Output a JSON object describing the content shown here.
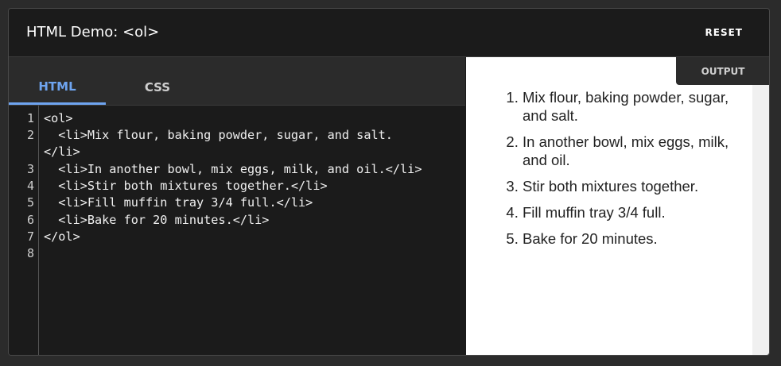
{
  "header": {
    "title": "HTML Demo: <ol>",
    "reset_label": "RESET"
  },
  "tabs": [
    {
      "label": "HTML"
    },
    {
      "label": "CSS"
    }
  ],
  "editor": {
    "line_numbers": [
      "1",
      "2",
      "3",
      "4",
      "5",
      "6",
      "7",
      "8"
    ],
    "lines": [
      "<ol>",
      "  <li>Mix flour, baking powder, sugar, and salt.",
      "</li>",
      "  <li>In another bowl, mix eggs, milk, and oil.</li>",
      "  <li>Stir both mixtures together.</li>",
      "  <li>Fill muffin tray 3/4 full.</li>",
      "  <li>Bake for 20 minutes.</li>",
      "</ol>"
    ]
  },
  "output": {
    "label": "OUTPUT",
    "items": [
      "Mix flour, baking powder, sugar, and salt.",
      "In another bowl, mix eggs, milk, and oil.",
      "Stir both mixtures together.",
      "Fill muffin tray 3/4 full.",
      "Bake for 20 minutes."
    ]
  },
  "colors": {
    "accent": "#6ea4f0",
    "editor_bg": "#1b1b1b",
    "panel_bg": "#2b2b2b",
    "output_bg": "#ffffff"
  }
}
